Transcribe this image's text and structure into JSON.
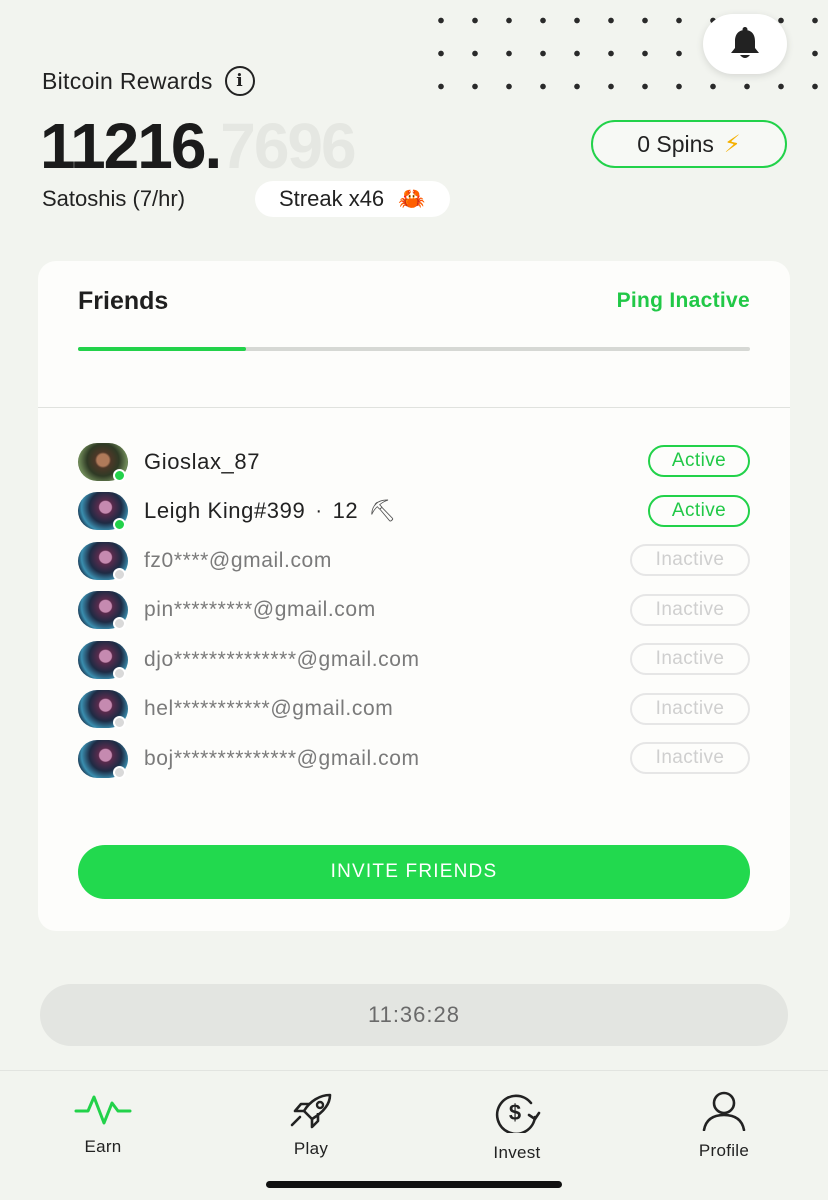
{
  "header": {
    "rewards_label": "Bitcoin Rewards",
    "balance_whole": "11216.",
    "balance_fraction": "7696",
    "rate_label": "Satoshis (7/hr)",
    "streak_label": "Streak x46",
    "streak_emoji": "🦀",
    "spins_label": "0 Spins",
    "spins_emoji": "⚡"
  },
  "friends_card": {
    "title": "Friends",
    "ping_label": "Ping Inactive",
    "progress": 0.25,
    "friends": [
      {
        "name": "Gioslax_87",
        "status": "Active",
        "online": true
      },
      {
        "name": "Leigh King#399",
        "extra": "12",
        "online": true,
        "status": "Active"
      },
      {
        "name": "fz0****@gmail.com",
        "status": "Inactive",
        "online": false
      },
      {
        "name": "pin*********@gmail.com",
        "status": "Inactive",
        "online": false
      },
      {
        "name": "djo**************@gmail.com",
        "status": "Inactive",
        "online": false
      },
      {
        "name": "hel***********@gmail.com",
        "status": "Inactive",
        "online": false
      },
      {
        "name": "boj**************@gmail.com",
        "status": "Inactive",
        "online": false
      }
    ],
    "invite_label": "INVITE FRIENDS"
  },
  "timer": "11:36:28",
  "tabs": [
    {
      "label": "Earn",
      "icon": "activity-icon"
    },
    {
      "label": "Play",
      "icon": "rocket-icon"
    },
    {
      "label": "Invest",
      "icon": "dollar-refresh-icon"
    },
    {
      "label": "Profile",
      "icon": "user-icon"
    }
  ],
  "colors": {
    "accent": "#22d24a",
    "background": "#f2f4ef"
  }
}
